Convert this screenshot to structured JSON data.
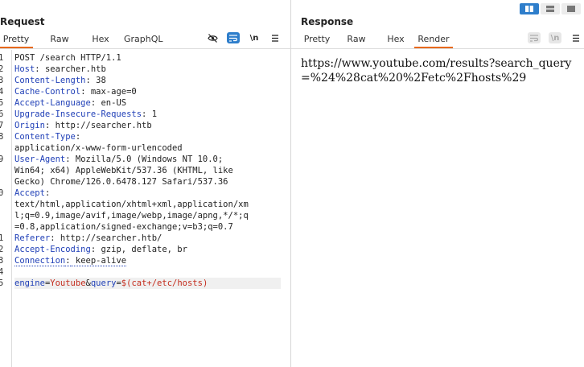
{
  "request": {
    "title": "Request",
    "tabs": [
      "Pretty",
      "Raw",
      "Hex",
      "GraphQL"
    ],
    "active_tab": "Pretty",
    "tools": [
      "eye-off-icon",
      "wrap-lines-icon",
      "newline-toggle",
      "menu-icon"
    ],
    "newline_label": "\\n",
    "lines": [
      {
        "num": "1",
        "text": "POST /search HTTP/1.1"
      },
      {
        "num": "2",
        "key": "Host",
        "val": " searcher.htb"
      },
      {
        "num": "3",
        "key": "Content-Length",
        "val": " 38"
      },
      {
        "num": "4",
        "key": "Cache-Control",
        "val": " max-age=0"
      },
      {
        "num": "5",
        "key": "Accept-Language",
        "val": " en-US"
      },
      {
        "num": "6",
        "key": "Upgrade-Insecure-Requests",
        "val": " 1"
      },
      {
        "num": "7",
        "key": "Origin",
        "val": " http://searcher.htb"
      },
      {
        "num": "8",
        "key": "Content-Type",
        "val": ""
      },
      {
        "num": "",
        "text": "application/x-www-form-urlencoded"
      },
      {
        "num": "9",
        "key": "User-Agent",
        "val": " Mozilla/5.0 (Windows NT 10.0;"
      },
      {
        "num": "",
        "text": "Win64; x64) AppleWebKit/537.36 (KHTML, like"
      },
      {
        "num": "",
        "text": "Gecko) Chrome/126.0.6478.127 Safari/537.36"
      },
      {
        "num": "0",
        "key": "Accept",
        "val": ""
      },
      {
        "num": "",
        "text": "text/html,application/xhtml+xml,application/xm"
      },
      {
        "num": "",
        "text": "l;q=0.9,image/avif,image/webp,image/apng,*/*;q"
      },
      {
        "num": "",
        "text": "=0.8,application/signed-exchange;v=b3;q=0.7"
      },
      {
        "num": "1",
        "key": "Referer",
        "val": " http://searcher.htb/"
      },
      {
        "num": "2",
        "key": "Accept-Encoding",
        "val": " gzip, deflate, br"
      },
      {
        "num": "3",
        "key": "Connection",
        "val": " keep-alive",
        "dotted": true
      },
      {
        "num": "4",
        "text": ""
      },
      {
        "num": "5",
        "body": true
      }
    ],
    "body": {
      "p1_name": "engine",
      "eq1": "=",
      "p1_val": "Youtube",
      "amp": "&",
      "p2_name": "query",
      "eq2": "=",
      "p2_val": "$(cat+/etc/hosts)"
    }
  },
  "response": {
    "title": "Response",
    "tabs": [
      "Pretty",
      "Raw",
      "Hex",
      "Render"
    ],
    "active_tab": "Render",
    "render_text": "https://www.youtube.com/results?search_query=%24%28cat%20%2Fetc%2Fhosts%29"
  },
  "layout_modes": [
    "side-by-side",
    "stacked",
    "tabs"
  ],
  "accent_color": "#e8691d",
  "active_tool_color": "#2e7ecb"
}
